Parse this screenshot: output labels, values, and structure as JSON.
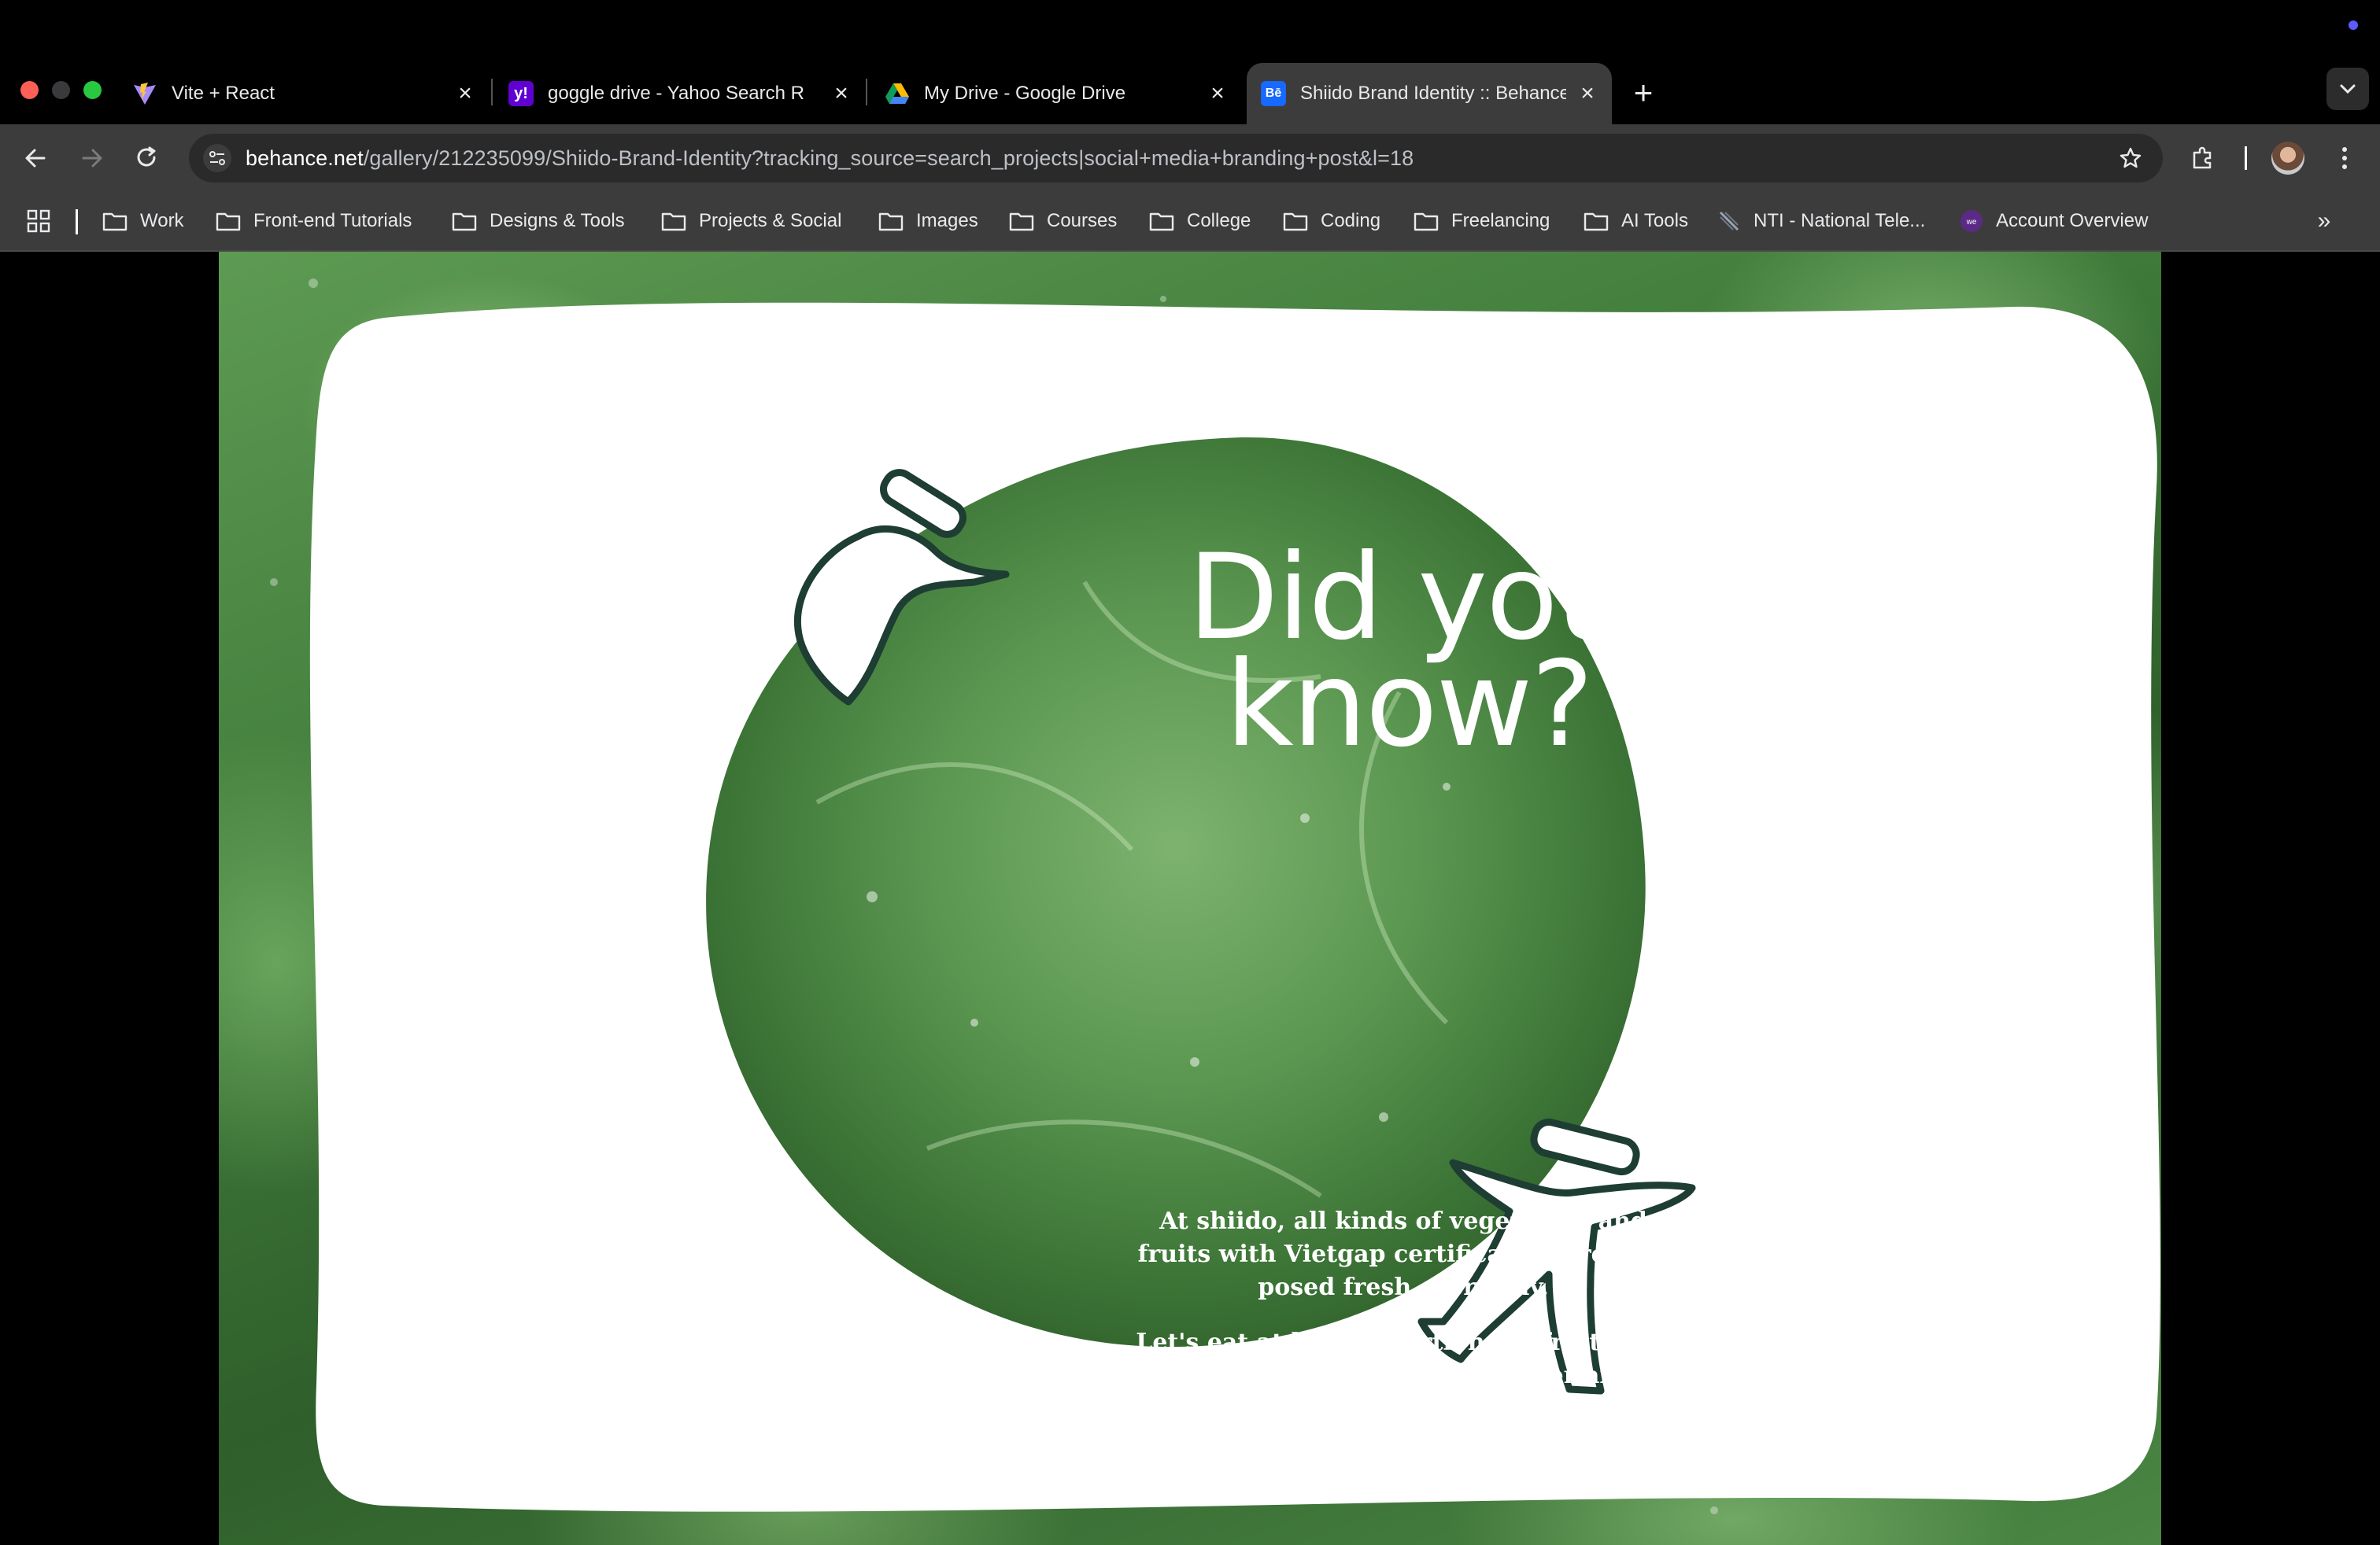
{
  "browser": {
    "tabs": [
      {
        "title": "Vite + React",
        "favicon": "vite-icon",
        "active": false
      },
      {
        "title": "goggle drive - Yahoo Search R",
        "favicon": "yahoo-icon",
        "active": false
      },
      {
        "title": "My Drive - Google Drive",
        "favicon": "google-drive-icon",
        "active": false
      },
      {
        "title": "Shiido Brand Identity :: Behance",
        "favicon": "behance-icon",
        "active": true
      }
    ],
    "url_host": "behance.net",
    "url_path": "/gallery/212235099/Shiido-Brand-Identity?tracking_source=search_projects|social+media+branding+post&l=18"
  },
  "bookmarks": [
    {
      "label": "Work",
      "icon": "folder-icon"
    },
    {
      "label": "Front-end Tutorials",
      "icon": "folder-icon"
    },
    {
      "label": "Designs & Tools",
      "icon": "folder-icon"
    },
    {
      "label": "Projects & Social",
      "icon": "folder-icon"
    },
    {
      "label": "Images",
      "icon": "folder-icon"
    },
    {
      "label": "Courses",
      "icon": "folder-icon"
    },
    {
      "label": "College",
      "icon": "folder-icon"
    },
    {
      "label": "Coding",
      "icon": "folder-icon"
    },
    {
      "label": "Freelancing",
      "icon": "folder-icon"
    },
    {
      "label": "AI Tools",
      "icon": "folder-icon"
    },
    {
      "label": "NTI - National Tele...",
      "icon": "nti-icon"
    },
    {
      "label": "Account Overview",
      "icon": "account-icon"
    }
  ],
  "artwork": {
    "headline_line1": "Did you",
    "headline_line2": "know?",
    "paragraph1": "At shiido, all kinds of vegetables and fruits with Vietgap certification are pro-posed fresh every day.",
    "paragraph2": "Let's eat at least 5 portions of fruits and greens per day to live a longer and healthier life!",
    "colors": {
      "card": "#ffffff",
      "character_stroke": "#1e3d33",
      "leaf_green": "#4f8b45"
    }
  }
}
